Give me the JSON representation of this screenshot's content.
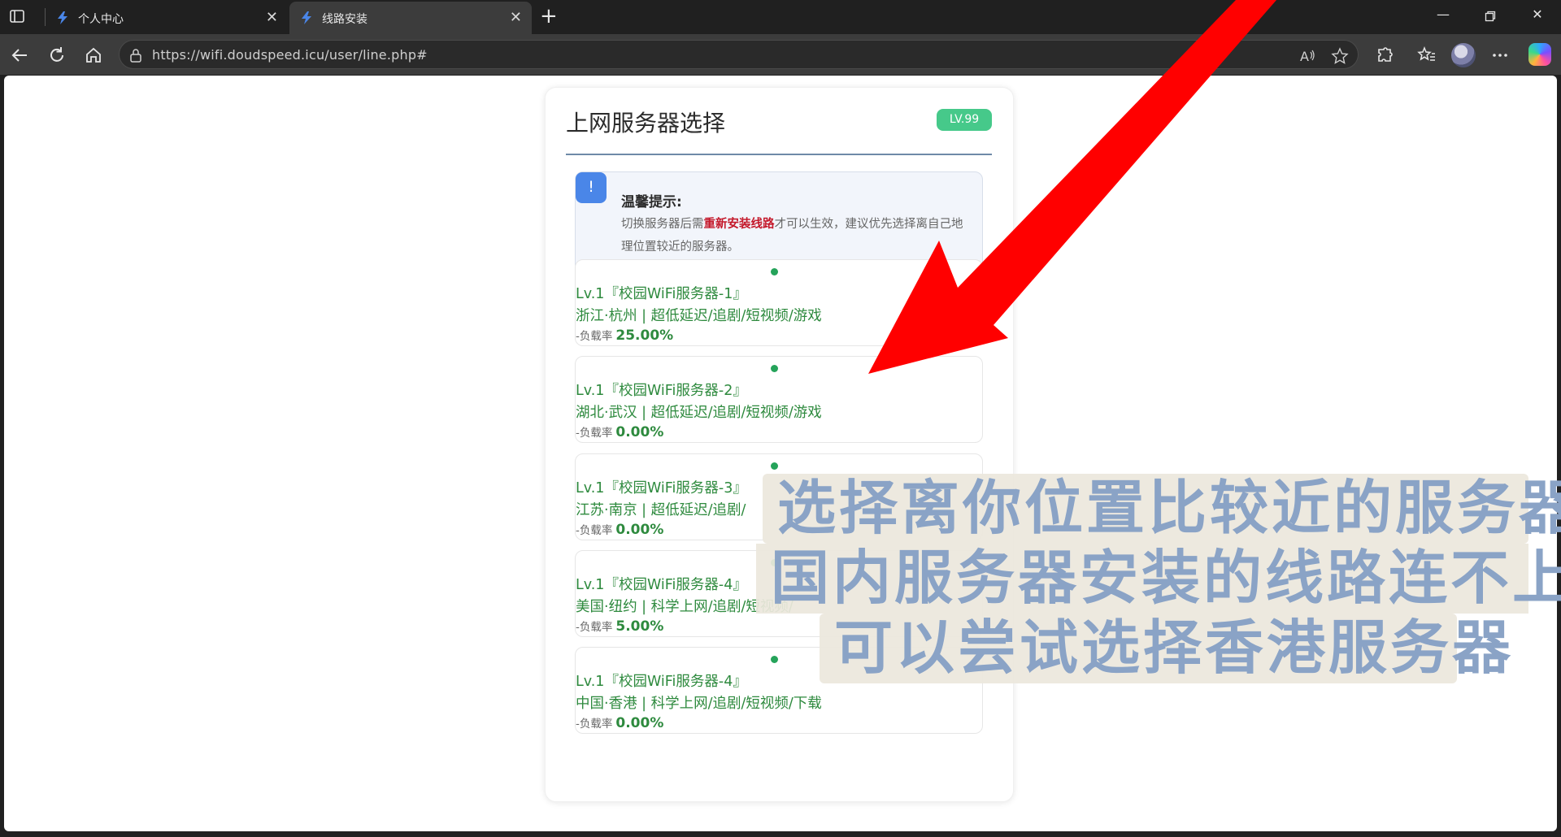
{
  "browser": {
    "tabs": [
      {
        "title": "个人中心",
        "active": false
      },
      {
        "title": "线路安装",
        "active": true
      }
    ],
    "url": "https://wifi.doudspeed.icu/user/line.php#",
    "read_aloud_label": "A̅"
  },
  "page": {
    "title": "上网服务器选择",
    "level_badge": "LV.99",
    "notice": {
      "icon_text": "!",
      "title": "温馨提示:",
      "body_before": "切换服务器后需",
      "body_highlight": "重新安装线路",
      "body_after": "才可以生效，建议优先选择离自己地理位置较近的服务器。"
    },
    "servers": [
      {
        "name": "Lv.1『校园WiFi服务器-1』",
        "location": "浙江·杭州 | 超低延迟/追剧/短视频/游戏",
        "load_label": "-负载率",
        "load": "25.00%"
      },
      {
        "name": "Lv.1『校园WiFi服务器-2』",
        "location": "湖北·武汉 | 超低延迟/追剧/短视频/游戏",
        "load_label": "-负载率",
        "load": "0.00%"
      },
      {
        "name": "Lv.1『校园WiFi服务器-3』",
        "location": "江苏·南京 | 超低延迟/追剧/",
        "load_label": "-负载率",
        "load": "0.00%"
      },
      {
        "name": "Lv.1『校园WiFi服务器-4』",
        "location": "美国·纽约 | 科学上网/追剧/短视频/",
        "load_label": "-负载率",
        "load": "5.00%"
      },
      {
        "name": "Lv.1『校园WiFi服务器-4』",
        "location": "中国·香港 | 科学上网/追剧/短视频/下载",
        "load_label": "-负载率",
        "load": "0.00%"
      }
    ]
  },
  "overlay": {
    "caption_lines": [
      "选择离你位置比较近的服务器",
      "国内服务器安装的线路连不上",
      "可以尝试选择香港服务器"
    ],
    "arrow_color": "#ff0000"
  },
  "colors": {
    "accent_green": "#2e8a3e",
    "badge_green": "#46c98a",
    "notice_blue": "#4a86e8",
    "highlight_red": "#c4192b",
    "caption_text": "#8aa3c6"
  }
}
